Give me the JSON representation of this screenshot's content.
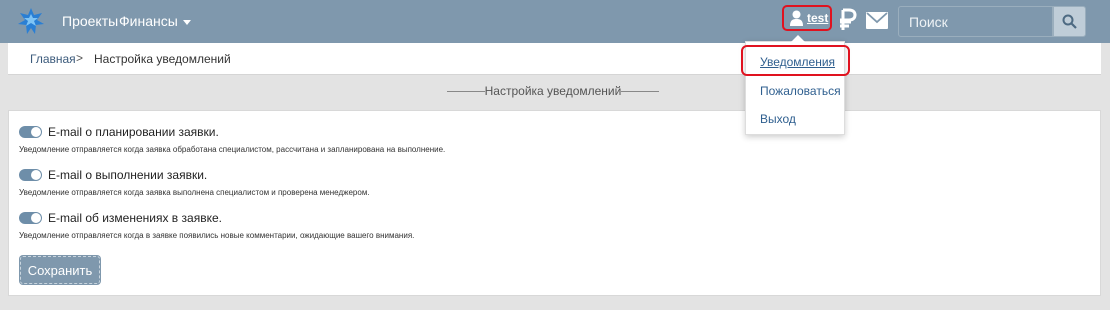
{
  "nav": {
    "projects": "Проекты",
    "finance": "Финансы",
    "username": "test",
    "search_placeholder": "Поиск"
  },
  "breadcrumb": {
    "home": "Главная",
    "separator": ">",
    "current": "Настройка уведомлений"
  },
  "section_title": "Настройка уведомлений",
  "options": [
    {
      "label": "E-mail о планировании заявки.",
      "description": "Уведомление отправляется когда заявка обработана специалистом, рассчитана и запланирована на выполнение.",
      "enabled": true
    },
    {
      "label": "E-mail о выполнении заявки.",
      "description": "Уведомление отправляется когда заявка выполнена специалистом и проверена менеджером.",
      "enabled": true
    },
    {
      "label": "E-mail об изменениях в заявке.",
      "description": "Уведомление отправляется когда в заявке появились новые комментарии, ожидающие вашего внимания.",
      "enabled": true
    }
  ],
  "save_label": "Сохранить",
  "user_menu": {
    "items": [
      "Уведомления",
      "Пожаловаться",
      "Выход"
    ]
  },
  "colors": {
    "navbar": "#7f98ad",
    "toggle": "#6e8ea9",
    "highlight": "#e0121f"
  },
  "icons": [
    "logo-icon",
    "user-icon",
    "ruble-icon",
    "mail-icon",
    "search-icon",
    "caret-down-icon"
  ]
}
